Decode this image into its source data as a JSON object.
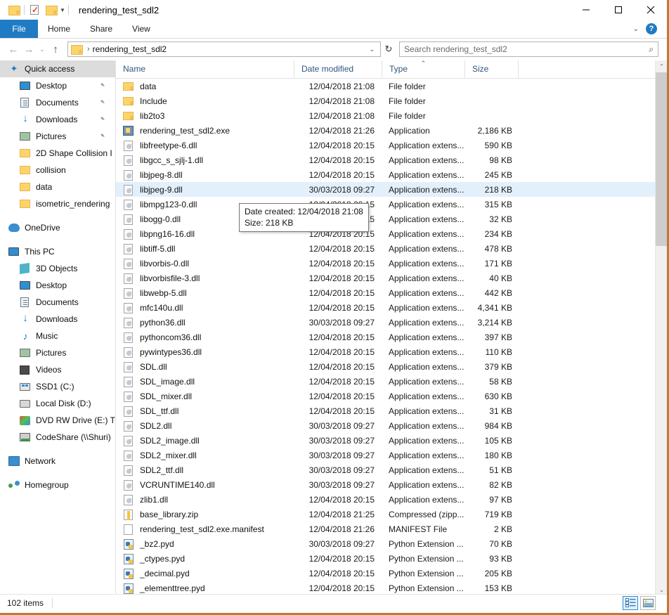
{
  "window": {
    "title": "rendering_test_sdl2",
    "quick_access_toolbar": [
      {
        "name": "folder-icon",
        "label": "Properties folder"
      },
      {
        "name": "properties-icon",
        "label": "Properties"
      },
      {
        "name": "new-folder-icon",
        "label": "New folder"
      },
      {
        "name": "customize-caret-icon",
        "label": "Customize Quick Access Toolbar"
      }
    ],
    "caption": {
      "minimize": "—",
      "maximize": "□",
      "close": "✕"
    }
  },
  "ribbon": {
    "tabs": [
      {
        "label": "File",
        "active_blue": true
      },
      {
        "label": "Home",
        "active_blue": false
      },
      {
        "label": "Share",
        "active_blue": false
      },
      {
        "label": "View",
        "active_blue": false
      }
    ],
    "expand_caret": "⌄",
    "help_label": "?"
  },
  "navigation": {
    "back": "←",
    "forward": "→",
    "recent": "⌄",
    "up": "↑",
    "address": {
      "crumb_separator": "›",
      "path": "rendering_test_sdl2",
      "caret": "⌄"
    },
    "refresh": "↻",
    "search": {
      "placeholder": "Search rendering_test_sdl2",
      "icon": "⌕"
    }
  },
  "sidebar": {
    "items": [
      {
        "label": "Quick access",
        "icon": "star-pin-icon",
        "level": "root",
        "selected": true,
        "pinned": false
      },
      {
        "label": "Desktop",
        "icon": "monitor-icon",
        "level": "child",
        "selected": false,
        "pinned": true
      },
      {
        "label": "Documents",
        "icon": "document-icon",
        "level": "child",
        "selected": false,
        "pinned": true
      },
      {
        "label": "Downloads",
        "icon": "download-arrow-icon",
        "level": "child",
        "selected": false,
        "pinned": true
      },
      {
        "label": "Pictures",
        "icon": "picture-icon",
        "level": "child",
        "selected": false,
        "pinned": true
      },
      {
        "label": "2D Shape Collision I",
        "icon": "folder-icon",
        "level": "child",
        "selected": false,
        "pinned": false
      },
      {
        "label": "collision",
        "icon": "folder-icon",
        "level": "child",
        "selected": false,
        "pinned": false
      },
      {
        "label": "data",
        "icon": "folder-icon",
        "level": "child",
        "selected": false,
        "pinned": false
      },
      {
        "label": "isometric_rendering",
        "icon": "folder-icon",
        "level": "child",
        "selected": false,
        "pinned": false
      },
      {
        "label": "OneDrive",
        "icon": "cloud-icon",
        "level": "root",
        "selected": false,
        "pinned": false,
        "gap_before": true
      },
      {
        "label": "This PC",
        "icon": "monitor-icon",
        "level": "root",
        "selected": false,
        "pinned": false,
        "gap_before": true
      },
      {
        "label": "3D Objects",
        "icon": "cube-icon",
        "level": "child",
        "selected": false,
        "pinned": false
      },
      {
        "label": "Desktop",
        "icon": "monitor-icon",
        "level": "child",
        "selected": false,
        "pinned": false
      },
      {
        "label": "Documents",
        "icon": "document-icon",
        "level": "child",
        "selected": false,
        "pinned": false
      },
      {
        "label": "Downloads",
        "icon": "download-arrow-icon",
        "level": "child",
        "selected": false,
        "pinned": false
      },
      {
        "label": "Music",
        "icon": "music-note-icon",
        "level": "child",
        "selected": false,
        "pinned": false
      },
      {
        "label": "Pictures",
        "icon": "picture-icon",
        "level": "child",
        "selected": false,
        "pinned": false
      },
      {
        "label": "Videos",
        "icon": "video-icon",
        "level": "child",
        "selected": false,
        "pinned": false
      },
      {
        "label": "SSD1 (C:)",
        "icon": "ssd-drive-icon",
        "level": "child",
        "selected": false,
        "pinned": false
      },
      {
        "label": "Local Disk (D:)",
        "icon": "drive-icon",
        "level": "child",
        "selected": false,
        "pinned": false
      },
      {
        "label": "DVD RW Drive (E:) T",
        "icon": "dvd-drive-icon",
        "level": "child",
        "selected": false,
        "pinned": false
      },
      {
        "label": "CodeShare (\\\\Shuri)",
        "icon": "network-drive-icon",
        "level": "child",
        "selected": false,
        "pinned": false
      },
      {
        "label": "Network",
        "icon": "network-icon",
        "level": "root",
        "selected": false,
        "pinned": false,
        "gap_before": true
      },
      {
        "label": "Homegroup",
        "icon": "homegroup-icon",
        "level": "root",
        "selected": false,
        "pinned": false,
        "gap_before": true
      }
    ]
  },
  "filelist": {
    "columns": [
      {
        "key": "name",
        "label": "Name",
        "sorted": false
      },
      {
        "key": "date",
        "label": "Date modified",
        "sorted": false
      },
      {
        "key": "type",
        "label": "Type",
        "sorted": true,
        "sort_arrow": "⌃"
      },
      {
        "key": "size",
        "label": "Size",
        "sorted": false
      }
    ],
    "rows": [
      {
        "name": "data",
        "date": "12/04/2018 21:08",
        "type": "File folder",
        "size": "",
        "icon": "folder-icon",
        "selected": false
      },
      {
        "name": "Include",
        "date": "12/04/2018 21:08",
        "type": "File folder",
        "size": "",
        "icon": "folder-icon",
        "selected": false
      },
      {
        "name": "lib2to3",
        "date": "12/04/2018 21:08",
        "type": "File folder",
        "size": "",
        "icon": "folder-icon",
        "selected": false
      },
      {
        "name": "rendering_test_sdl2.exe",
        "date": "12/04/2018 21:26",
        "type": "Application",
        "size": "2,186 KB",
        "icon": "application-icon",
        "selected": false
      },
      {
        "name": "libfreetype-6.dll",
        "date": "12/04/2018 20:15",
        "type": "Application extens...",
        "size": "590 KB",
        "icon": "dll-icon",
        "selected": false
      },
      {
        "name": "libgcc_s_sjlj-1.dll",
        "date": "12/04/2018 20:15",
        "type": "Application extens...",
        "size": "98 KB",
        "icon": "dll-icon",
        "selected": false
      },
      {
        "name": "libjpeg-8.dll",
        "date": "12/04/2018 20:15",
        "type": "Application extens...",
        "size": "245 KB",
        "icon": "dll-icon",
        "selected": false
      },
      {
        "name": "libjpeg-9.dll",
        "date": "30/03/2018 09:27",
        "type": "Application extens...",
        "size": "218 KB",
        "icon": "dll-icon",
        "selected": true
      },
      {
        "name": "libmpg123-0.dll",
        "date": "12/04/2018 20:15",
        "type": "Application extens...",
        "size": "315 KB",
        "icon": "dll-icon",
        "selected": false
      },
      {
        "name": "libogg-0.dll",
        "date": "12/04/2018 20:15",
        "type": "Application extens...",
        "size": "32 KB",
        "icon": "dll-icon",
        "selected": false
      },
      {
        "name": "libpng16-16.dll",
        "date": "12/04/2018 20:15",
        "type": "Application extens...",
        "size": "234 KB",
        "icon": "dll-icon",
        "selected": false
      },
      {
        "name": "libtiff-5.dll",
        "date": "12/04/2018 20:15",
        "type": "Application extens...",
        "size": "478 KB",
        "icon": "dll-icon",
        "selected": false
      },
      {
        "name": "libvorbis-0.dll",
        "date": "12/04/2018 20:15",
        "type": "Application extens...",
        "size": "171 KB",
        "icon": "dll-icon",
        "selected": false
      },
      {
        "name": "libvorbisfile-3.dll",
        "date": "12/04/2018 20:15",
        "type": "Application extens...",
        "size": "40 KB",
        "icon": "dll-icon",
        "selected": false
      },
      {
        "name": "libwebp-5.dll",
        "date": "12/04/2018 20:15",
        "type": "Application extens...",
        "size": "442 KB",
        "icon": "dll-icon",
        "selected": false
      },
      {
        "name": "mfc140u.dll",
        "date": "12/04/2018 20:15",
        "type": "Application extens...",
        "size": "4,341 KB",
        "icon": "dll-icon",
        "selected": false
      },
      {
        "name": "python36.dll",
        "date": "30/03/2018 09:27",
        "type": "Application extens...",
        "size": "3,214 KB",
        "icon": "dll-icon",
        "selected": false
      },
      {
        "name": "pythoncom36.dll",
        "date": "12/04/2018 20:15",
        "type": "Application extens...",
        "size": "397 KB",
        "icon": "dll-icon",
        "selected": false
      },
      {
        "name": "pywintypes36.dll",
        "date": "12/04/2018 20:15",
        "type": "Application extens...",
        "size": "110 KB",
        "icon": "dll-icon",
        "selected": false
      },
      {
        "name": "SDL.dll",
        "date": "12/04/2018 20:15",
        "type": "Application extens...",
        "size": "379 KB",
        "icon": "dll-icon",
        "selected": false
      },
      {
        "name": "SDL_image.dll",
        "date": "12/04/2018 20:15",
        "type": "Application extens...",
        "size": "58 KB",
        "icon": "dll-icon",
        "selected": false
      },
      {
        "name": "SDL_mixer.dll",
        "date": "12/04/2018 20:15",
        "type": "Application extens...",
        "size": "630 KB",
        "icon": "dll-icon",
        "selected": false
      },
      {
        "name": "SDL_ttf.dll",
        "date": "12/04/2018 20:15",
        "type": "Application extens...",
        "size": "31 KB",
        "icon": "dll-icon",
        "selected": false
      },
      {
        "name": "SDL2.dll",
        "date": "30/03/2018 09:27",
        "type": "Application extens...",
        "size": "984 KB",
        "icon": "dll-icon",
        "selected": false
      },
      {
        "name": "SDL2_image.dll",
        "date": "30/03/2018 09:27",
        "type": "Application extens...",
        "size": "105 KB",
        "icon": "dll-icon",
        "selected": false
      },
      {
        "name": "SDL2_mixer.dll",
        "date": "30/03/2018 09:27",
        "type": "Application extens...",
        "size": "180 KB",
        "icon": "dll-icon",
        "selected": false
      },
      {
        "name": "SDL2_ttf.dll",
        "date": "30/03/2018 09:27",
        "type": "Application extens...",
        "size": "51 KB",
        "icon": "dll-icon",
        "selected": false
      },
      {
        "name": "VCRUNTIME140.dll",
        "date": "30/03/2018 09:27",
        "type": "Application extens...",
        "size": "82 KB",
        "icon": "dll-icon",
        "selected": false
      },
      {
        "name": "zlib1.dll",
        "date": "12/04/2018 20:15",
        "type": "Application extens...",
        "size": "97 KB",
        "icon": "dll-icon",
        "selected": false
      },
      {
        "name": "base_library.zip",
        "date": "12/04/2018 21:25",
        "type": "Compressed (zipp...",
        "size": "719 KB",
        "icon": "zip-icon",
        "selected": false
      },
      {
        "name": "rendering_test_sdl2.exe.manifest",
        "date": "12/04/2018 21:26",
        "type": "MANIFEST File",
        "size": "2 KB",
        "icon": "manifest-icon",
        "selected": false
      },
      {
        "name": "_bz2.pyd",
        "date": "30/03/2018 09:27",
        "type": "Python Extension ...",
        "size": "70 KB",
        "icon": "pyd-icon",
        "selected": false
      },
      {
        "name": "_ctypes.pyd",
        "date": "12/04/2018 20:15",
        "type": "Python Extension ...",
        "size": "93 KB",
        "icon": "pyd-icon",
        "selected": false
      },
      {
        "name": "_decimal.pyd",
        "date": "12/04/2018 20:15",
        "type": "Python Extension ...",
        "size": "205 KB",
        "icon": "pyd-icon",
        "selected": false
      },
      {
        "name": "_elementtree.pyd",
        "date": "12/04/2018 20:15",
        "type": "Python Extension ...",
        "size": "153 KB",
        "icon": "pyd-icon",
        "selected": false
      }
    ]
  },
  "tooltip": {
    "line1": "Date created: 12/04/2018 21:08",
    "line2": "Size: 218 KB"
  },
  "statusbar": {
    "item_count": "102 items",
    "views": [
      {
        "name": "details-view-button",
        "active": true
      },
      {
        "name": "large-icons-view-button",
        "active": false
      }
    ]
  },
  "scrollbar": {
    "up_arrow": "⌃",
    "down_arrow": "⌄"
  },
  "colors": {
    "accent": "#1f7bc4",
    "selection": "#e2f0fc",
    "header_text": "#31557f",
    "window_border": "#c07a33"
  }
}
